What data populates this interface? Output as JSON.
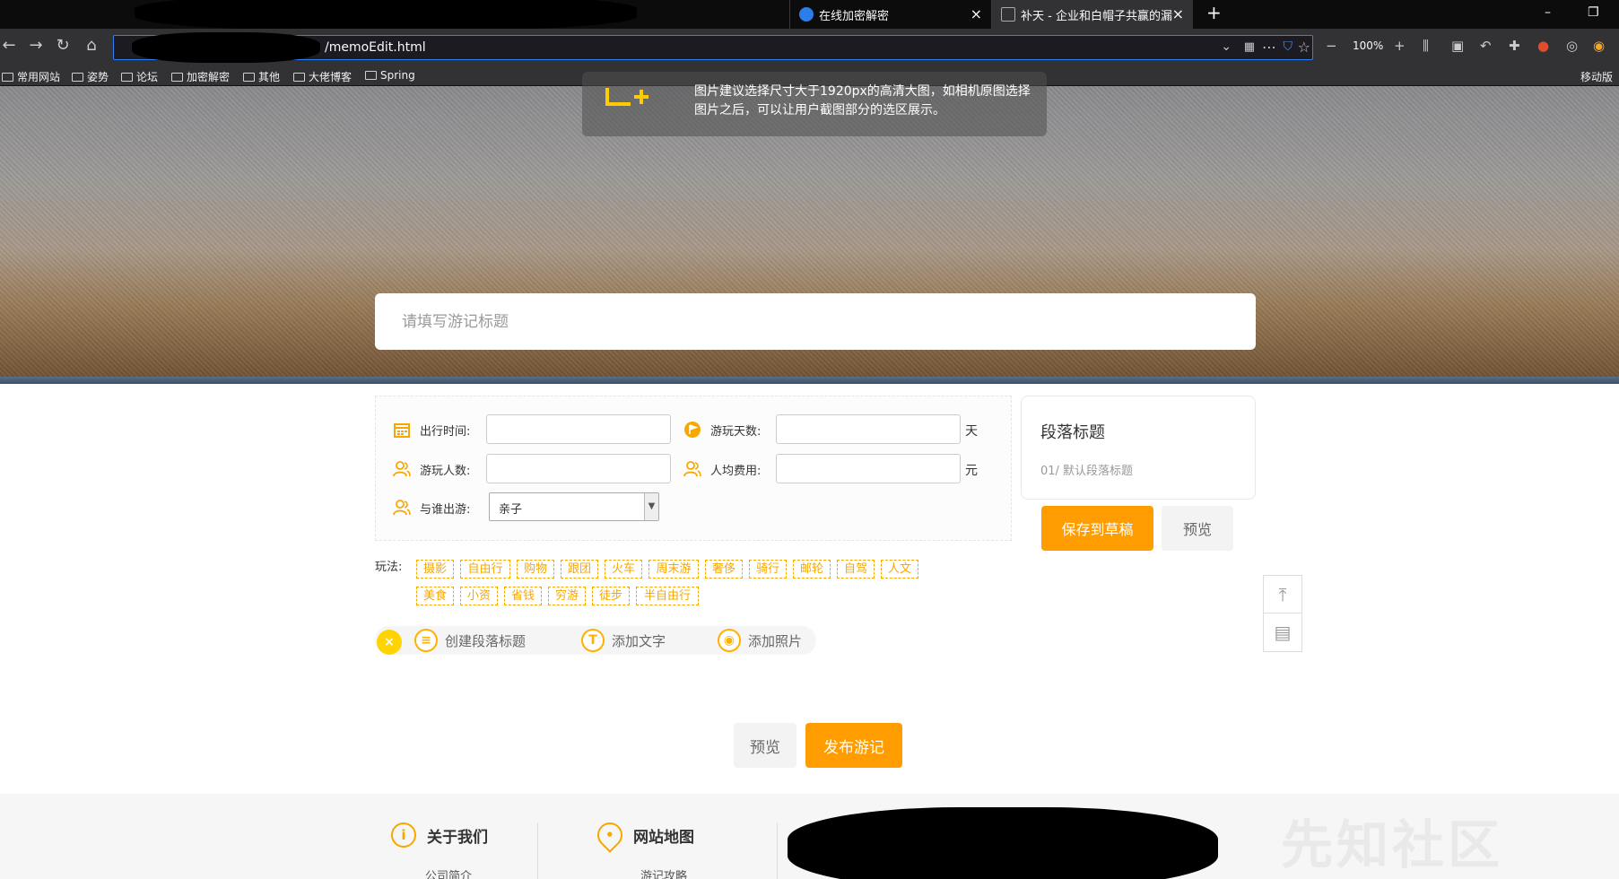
{
  "browser": {
    "tabs": [
      {
        "label": "在线加密解密",
        "icon_color": "#2b7de9"
      },
      {
        "label": "补天 - 企业和白帽子共赢的漏洞"
      }
    ],
    "url": "/memoEdit.html",
    "zoom": "100%",
    "mobile_bookmarks": "移动版",
    "bookmarks": [
      "常用网站",
      "姿势",
      "论坛",
      "加密解密",
      "其他",
      "大佬博客",
      "Spring"
    ]
  },
  "hero": {
    "hint": "图片建议选择尺寸大于1920px的高清大图，如相机原图选择图片之后，可以让用户截图部分的选区展示。",
    "title_placeholder": "请填写游记标题"
  },
  "form": {
    "depart_time_label": "出行时间:",
    "days_label": "游玩天数:",
    "days_unit": "天",
    "people_label": "游玩人数:",
    "cost_label": "人均费用:",
    "cost_unit": "元",
    "companion_label": "与谁出游:",
    "companion_value": "亲子"
  },
  "play": {
    "label": "玩法:",
    "tags_row1": [
      "摄影",
      "自由行",
      "购物",
      "跟团",
      "火车",
      "周末游",
      "奢侈",
      "骑行",
      "邮轮",
      "自驾",
      "人文"
    ],
    "tags_row2": [
      "美食",
      "小资",
      "省钱",
      "穷游",
      "徒步",
      "半自由行"
    ]
  },
  "actions": {
    "create_section": "创建段落标题",
    "add_text": "添加文字",
    "add_photo": "添加照片"
  },
  "sidebar": {
    "section_title": "段落标题",
    "section_item": "01/ 默认段落标题",
    "save_draft": "保存到草稿",
    "preview": "预览"
  },
  "bottom": {
    "preview": "预览",
    "publish": "发布游记"
  },
  "footer": {
    "about": "关于我们",
    "about_sub": "公司简介",
    "sitemap": "网站地图",
    "sitemap_sub": "游记攻略",
    "watermark": "先知社区"
  },
  "colors": {
    "accent": "#ff9d00",
    "tag": "#f7a800"
  }
}
